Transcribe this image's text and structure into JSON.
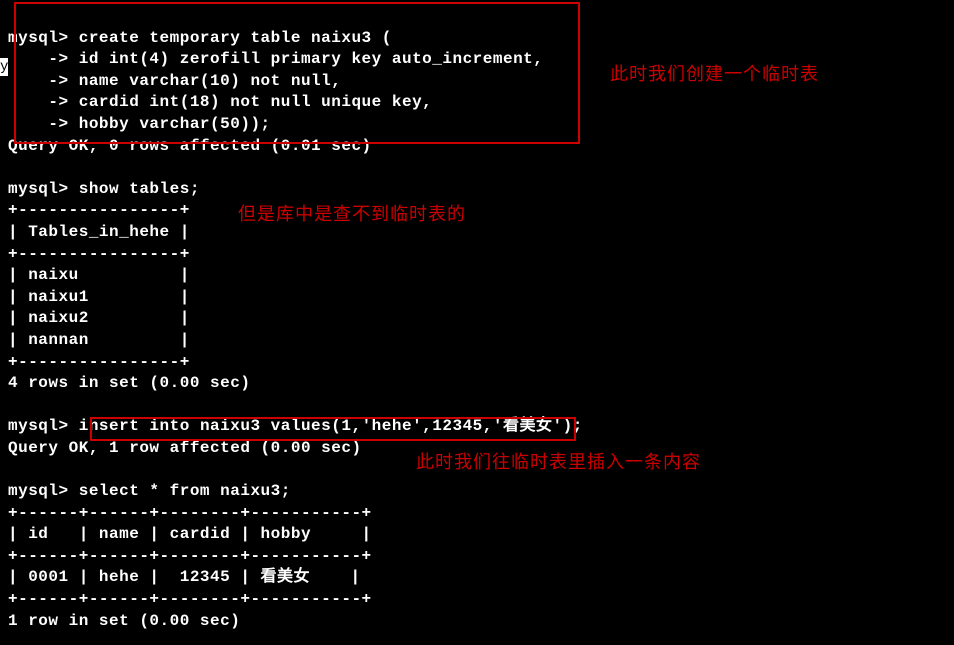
{
  "side_char": "y",
  "block1": {
    "l1": "mysql> create temporary table naixu3 (",
    "l2": "    -> id int(4) zerofill primary key auto_increment,",
    "l3": "    -> name varchar(10) not null,",
    "l4": "    -> cardid int(18) not null unique key,",
    "l5": "    -> hobby varchar(50));",
    "l6": "Query OK, 0 rows affected (0.01 sec)"
  },
  "block2": {
    "l1": "mysql> show tables;",
    "l2": "+----------------+",
    "l3": "| Tables_in_hehe |",
    "l4": "+----------------+",
    "l5": "| naixu          |",
    "l6": "| naixu1         |",
    "l7": "| naixu2         |",
    "l8": "| nannan         |",
    "l9": "+----------------+",
    "l10": "4 rows in set (0.00 sec)"
  },
  "block3": {
    "l1_prefix": "mysql> ",
    "l1_cmd": "insert into naixu3 values(1,'hehe',12345,'看美女');",
    "l2": "Query OK, 1 row affected (0.00 sec)"
  },
  "block4": {
    "l1": "mysql> select * from naixu3;",
    "l2": "+------+------+--------+-----------+",
    "l3": "| id   | name | cardid | hobby     |",
    "l4": "+------+------+--------+-----------+",
    "l5": "| 0001 | hehe |  12345 | 看美女    |",
    "l6": "+------+------+--------+-----------+",
    "l7": "1 row in set (0.00 sec)"
  },
  "annotations": {
    "a1": "此时我们创建一个临时表",
    "a2": "但是库中是查不到临时表的",
    "a3": "此时我们往临时表里插入一条内容"
  },
  "chart_data": {
    "type": "table",
    "tables": [
      {
        "title": "Tables_in_hehe",
        "rows": [
          "naixu",
          "naixu1",
          "naixu2",
          "nannan"
        ]
      },
      {
        "title": "naixu3",
        "columns": [
          "id",
          "name",
          "cardid",
          "hobby"
        ],
        "rows": [
          {
            "id": "0001",
            "name": "hehe",
            "cardid": 12345,
            "hobby": "看美女"
          }
        ]
      }
    ]
  }
}
